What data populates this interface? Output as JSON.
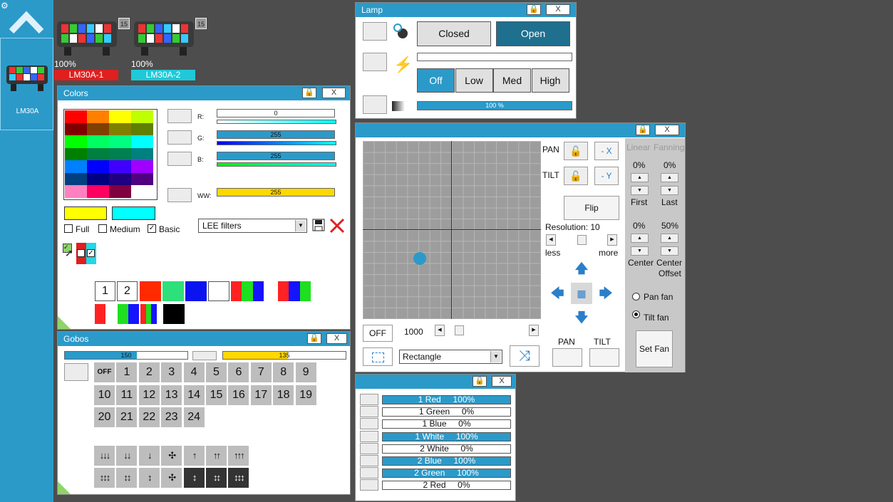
{
  "fixtures": [
    {
      "count": "15",
      "percent": "100%",
      "name": "LM30A-1",
      "color": "#e01f1f"
    },
    {
      "count": "15",
      "percent": "100%",
      "name": "LM30A-2",
      "color": "#1fc9d8"
    }
  ],
  "sidebar": {
    "fixture_label": "LM30A"
  },
  "colors": {
    "title": "Colors",
    "lock_icon": "lock-icon",
    "close_label": "X",
    "palette": [
      [
        "#ff0000",
        "#ff8000",
        "#ffff00",
        "#c0ff00"
      ],
      [
        "#800000",
        "#804000",
        "#808000",
        "#608000"
      ],
      [
        "#00ff00",
        "#00ff60",
        "#00ff80",
        "#00ffff"
      ],
      [
        "#008000",
        "#008040",
        "#008050",
        "#008080"
      ],
      [
        "#0080ff",
        "#0000ff",
        "#4000ff",
        "#a000ff"
      ],
      [
        "#004080",
        "#000080",
        "#200080",
        "#500080"
      ],
      [
        "#ff80c0",
        "#ff0060",
        "#800040",
        "#ffffff"
      ]
    ],
    "channels": [
      {
        "label": "R:",
        "value": "0",
        "fill": 0.0,
        "bar_color": "#2b9ac9"
      },
      {
        "label": "G:",
        "value": "255",
        "fill": 1.0,
        "bar_color": "#2b9ac9"
      },
      {
        "label": "B:",
        "value": "255",
        "fill": 1.0,
        "bar_color": "#2b9ac9"
      },
      {
        "label": "WW:",
        "value": "255",
        "fill": 1.0,
        "bar_color": "#ffd800"
      }
    ],
    "swatch_1": "#ffff00",
    "swatch_2": "#00ffff",
    "options": [
      {
        "label": "Full",
        "checked": false
      },
      {
        "label": "Medium",
        "checked": false
      },
      {
        "label": "Basic",
        "checked": true
      }
    ],
    "filter_select": "LEE filters",
    "presets_row1_labels": [
      "1",
      "2"
    ]
  },
  "gobos": {
    "title": "Gobos",
    "left_value": "150",
    "left_fill": 0.59,
    "right_value": "135",
    "right_fill": 0.53,
    "items": [
      "OFF",
      "1",
      "2",
      "3",
      "4",
      "5",
      "6",
      "7",
      "8",
      "9",
      "10",
      "11",
      "12",
      "13",
      "14",
      "15",
      "16",
      "17",
      "18",
      "19",
      "20",
      "21",
      "22",
      "23",
      "24"
    ],
    "arrows_row1": [
      "↓↓↓",
      "↓↓",
      "↓",
      "✣",
      "↑",
      "↑↑",
      "↑↑↑"
    ],
    "arrows_row2": [
      "↕↕↕",
      "↕↕",
      "↕",
      "✣",
      "↕",
      "↕↕",
      "↕↕↕"
    ]
  },
  "lamp": {
    "title": "Lamp",
    "shutter": [
      "Closed",
      "Open"
    ],
    "power": [
      "Off",
      "Low",
      "Med",
      "High"
    ],
    "dimmer": "100 %",
    "dimmer_fill": 1.0
  },
  "position": {
    "pan_label": "PAN",
    "tilt_label": "TILT",
    "invert_x": "- X",
    "invert_y": "- Y",
    "flip": "Flip",
    "resolution": "Resolution: 10",
    "less": "less",
    "more": "more",
    "off_button": "OFF",
    "speed": "1000",
    "shape_select": "Rectangle",
    "pan_bottom": "PAN",
    "tilt_bottom": "TILT",
    "linear": "Linear",
    "fanning": "Fanning",
    "first_value": "0%",
    "last_value": "0%",
    "first": "First",
    "last": "Last",
    "center_value": "0%",
    "offset_value": "50%",
    "center": "Center",
    "center_offset_1": "Center",
    "center_offset_2": "Offset",
    "pan_fan": "Pan fan",
    "tilt_fan": "Tilt fan",
    "set_fan": "Set Fan",
    "dot_x": 0.32,
    "dot_y": 0.66
  },
  "channels": {
    "rows": [
      {
        "label": "1 Red     100%",
        "on": true
      },
      {
        "label": "1 Green     0%",
        "on": false
      },
      {
        "label": "1 Blue     0%",
        "on": false
      },
      {
        "label": "1 White     100%",
        "on": true
      },
      {
        "label": "2 White     0%",
        "on": false
      },
      {
        "label": "2 Blue     100%",
        "on": true
      },
      {
        "label": "2 Green     100%",
        "on": true
      },
      {
        "label": "2 Red     0%",
        "on": false
      }
    ]
  },
  "accent": "#2b9ac9"
}
